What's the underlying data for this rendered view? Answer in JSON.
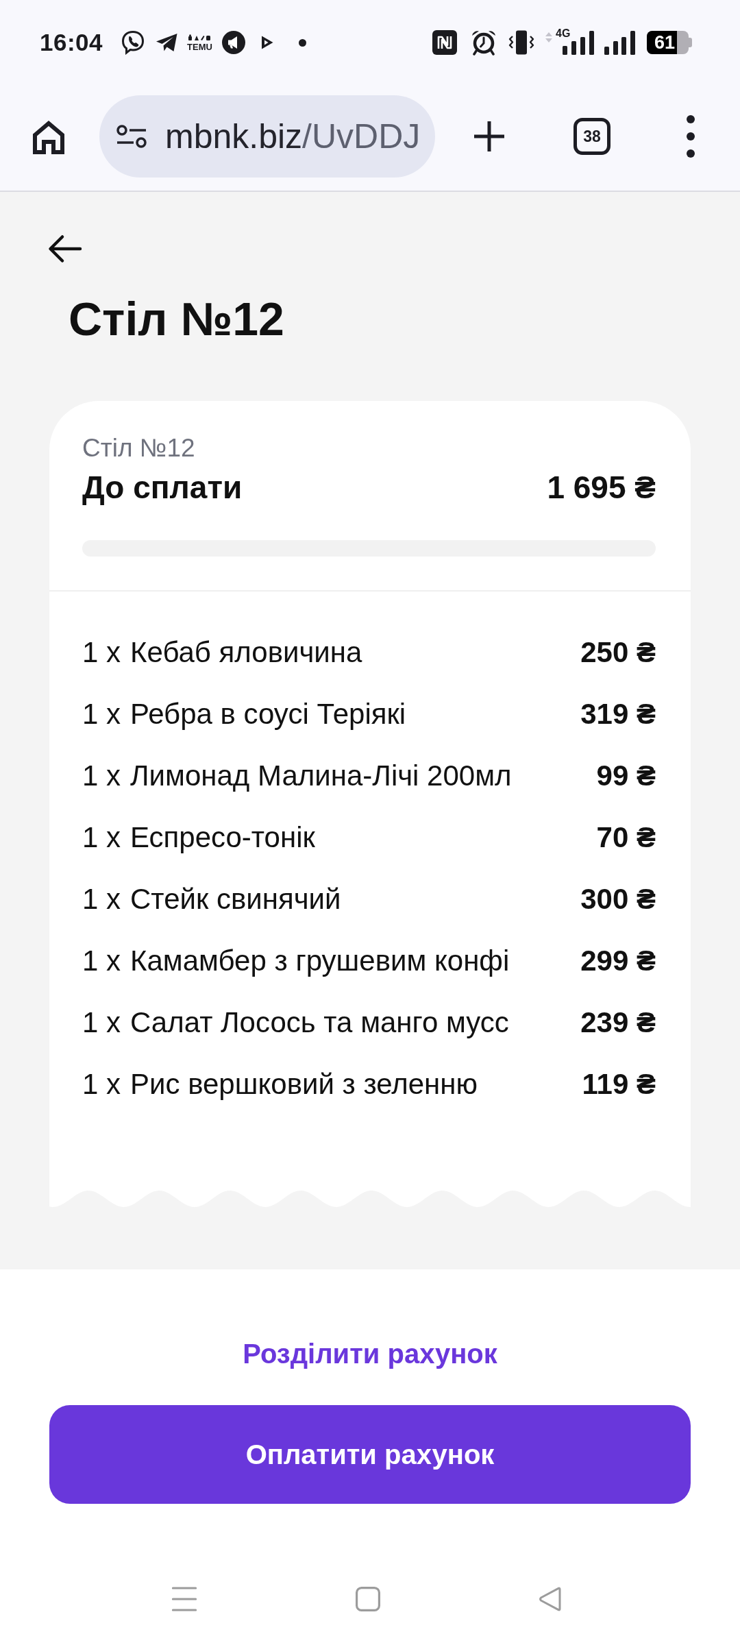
{
  "status_bar": {
    "time": "16:04",
    "app_label": "TEMU",
    "network_type": "4G",
    "battery": "61"
  },
  "browser_bar": {
    "url": {
      "host": "mbnk.biz",
      "path": "/UvDDJ"
    },
    "tab_count": "38"
  },
  "page": {
    "title": "Стіл №12"
  },
  "bill": {
    "table": "Стіл №12",
    "due_label": "До сплати",
    "due_amount": "1 695 ₴",
    "progress": {
      "level": 0
    },
    "items": [
      {
        "quantity": "1 x",
        "name": "Кебаб яловичина",
        "price": "250 ₴"
      },
      {
        "quantity": "1 x",
        "name": "Ребра в соусі Теріякі",
        "price": "319 ₴"
      },
      {
        "quantity": "1 x",
        "name": "Лимонад Малина-Лічі 200мл",
        "price": "99 ₴"
      },
      {
        "quantity": "1 x",
        "name": "Еспресо-тонік",
        "price": "70 ₴"
      },
      {
        "quantity": "1 x",
        "name": "Стейк свинячий",
        "price": "300 ₴"
      },
      {
        "quantity": "1 x",
        "name": "Камамбер з грушевим конфі",
        "price": "299 ₴"
      },
      {
        "quantity": "1 x",
        "name": "Салат Лосось та манго мусс",
        "price": "239 ₴"
      },
      {
        "quantity": "1 x",
        "name": "Рис вершковий з зеленню",
        "price": "119 ₴"
      }
    ]
  },
  "actions": {
    "split_link": "Розділити рахунок",
    "pay_button": "Оплатити рахунок"
  }
}
